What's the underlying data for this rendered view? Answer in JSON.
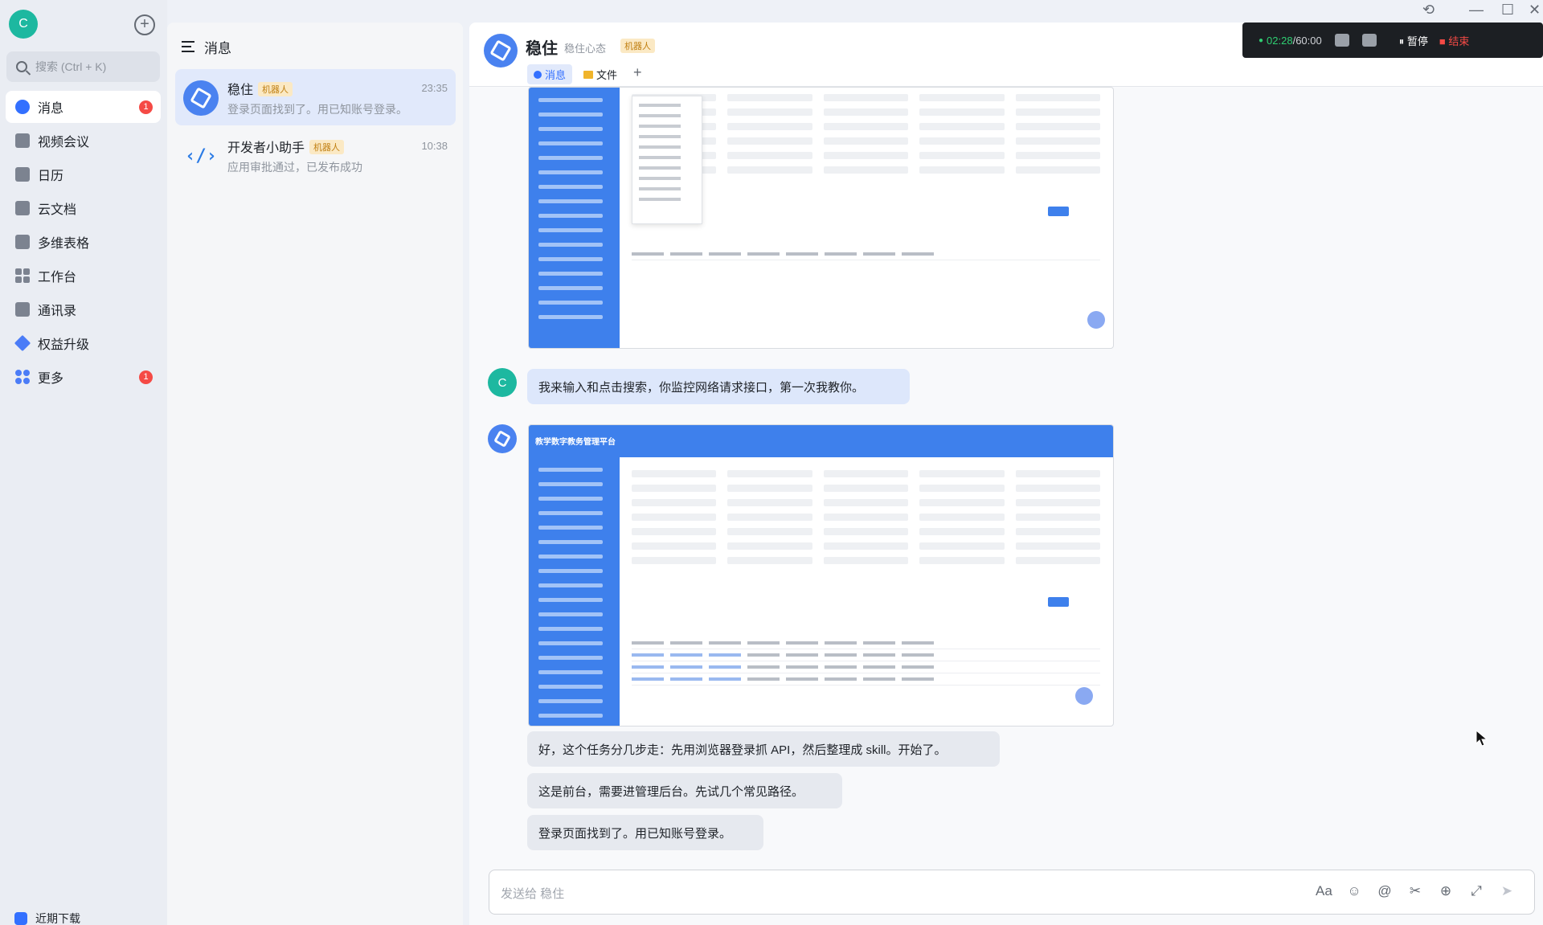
{
  "nav": {
    "avatar_letter": "C",
    "search_placeholder": "搜索 (Ctrl + K)",
    "items": [
      {
        "label": "消息",
        "badge": "1"
      },
      {
        "label": "视频会议"
      },
      {
        "label": "日历"
      },
      {
        "label": "云文档"
      },
      {
        "label": "多维表格"
      },
      {
        "label": "工作台"
      },
      {
        "label": "通讯录"
      },
      {
        "label": "权益升级"
      },
      {
        "label": "更多",
        "badge": "1"
      }
    ],
    "bottom_label": "近期下载"
  },
  "chat_list": {
    "title": "消息",
    "conversations": [
      {
        "name": "稳住",
        "tag": "机器人",
        "time": "23:35",
        "preview": "登录页面找到了。用已知账号登录。"
      },
      {
        "name": "开发者小助手",
        "tag": "机器人",
        "time": "10:38",
        "preview": "应用审批通过，已发布成功"
      }
    ]
  },
  "chat": {
    "title": "稳住",
    "subtitle": "稳住心态",
    "tag": "机器人",
    "tabs": [
      "消息",
      "文件"
    ],
    "messages": [
      {
        "from": "user",
        "avatar": "C",
        "text": "我来输入和点击搜索，你监控网络请求接口，第一次我教你。"
      },
      {
        "from": "bot",
        "text": "好，这个任务分几步走：先用浏览器登录抓 API，然后整理成 skill。开始了。"
      },
      {
        "from": "bot",
        "text": "这是前台，需要进管理后台。先试几个常见路径。"
      },
      {
        "from": "bot",
        "text": "登录页面找到了。用已知账号登录。"
      }
    ],
    "screenshot_title": "教学数字教务管理平台",
    "input_placeholder": "发送给 稳住"
  },
  "recording": {
    "elapsed": "02:28",
    "limit": "/60:00",
    "pause_label": "暂停",
    "stop_label": "结束"
  },
  "colors": {
    "accent": "#3370ff",
    "user_avatar": "#1db8a0",
    "badge": "#f54a45",
    "tag_bg": "#fbe9c4"
  }
}
